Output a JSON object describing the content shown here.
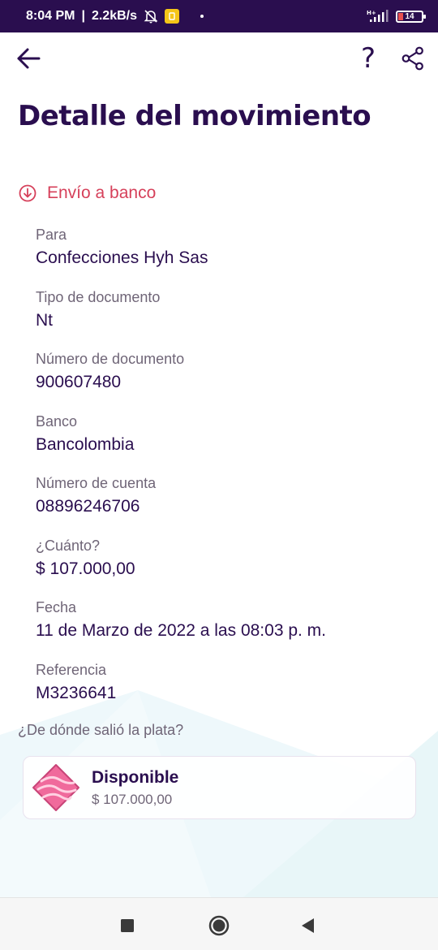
{
  "status_bar": {
    "time": "8:04 PM",
    "separator": "|",
    "speed": "2.2kB/s",
    "network": "H+",
    "battery": "14",
    "icons": [
      "bell-off-icon",
      "app-notification-icon",
      "signal-icon",
      "battery-icon"
    ]
  },
  "app_bar": {
    "back_icon": "arrow-left-icon",
    "help_label": "?",
    "share_icon": "share-icon"
  },
  "page": {
    "title": "Detalle del movimiento",
    "movement_type": "Envío a banco",
    "movement_icon": "arrow-down-circle-icon"
  },
  "details": [
    {
      "label": "Para",
      "value": "Confecciones Hyh Sas"
    },
    {
      "label": "Tipo de documento",
      "value": "Nt"
    },
    {
      "label": "Número de documento",
      "value": "900607480"
    },
    {
      "label": "Banco",
      "value": "Bancolombia"
    },
    {
      "label": "Número de cuenta",
      "value": "08896246706"
    },
    {
      "label": "¿Cuánto?",
      "value": "$ 107.000,00"
    },
    {
      "label": "Fecha",
      "value": "11 de Marzo de 2022 a las 08:03 p. m."
    },
    {
      "label": "Referencia",
      "value": "M3236641"
    }
  ],
  "source": {
    "question": "¿De dónde salió la plata?",
    "name": "Disponible",
    "amount": "$ 107.000,00",
    "icon": "pocket-icon"
  },
  "nav_bar": {
    "icons": [
      "recent-apps-icon",
      "home-icon",
      "back-triangle-icon"
    ]
  },
  "colors": {
    "primary": "#2a0e4f",
    "accent": "#d6405a",
    "muted": "#6f6577",
    "pocket": "#f06a9c"
  }
}
